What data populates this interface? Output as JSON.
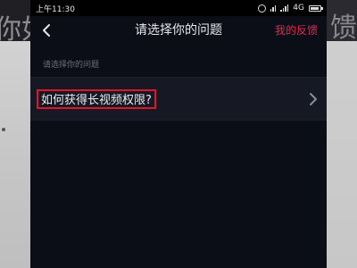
{
  "background": {
    "left_fragment": "你如",
    "right_fragment": "馈"
  },
  "status_bar": {
    "time": "上午11:30",
    "network": "4G"
  },
  "header": {
    "title": "请选择你的问题",
    "feedback_link": "我的反馈"
  },
  "section_label": "请选择你的问题",
  "questions": [
    {
      "label": "如何获得长视频权限?"
    }
  ],
  "colors": {
    "accent": "#e0294f",
    "highlight_border": "#e0142a",
    "background": "#0c0e17",
    "row_background": "#161924"
  }
}
